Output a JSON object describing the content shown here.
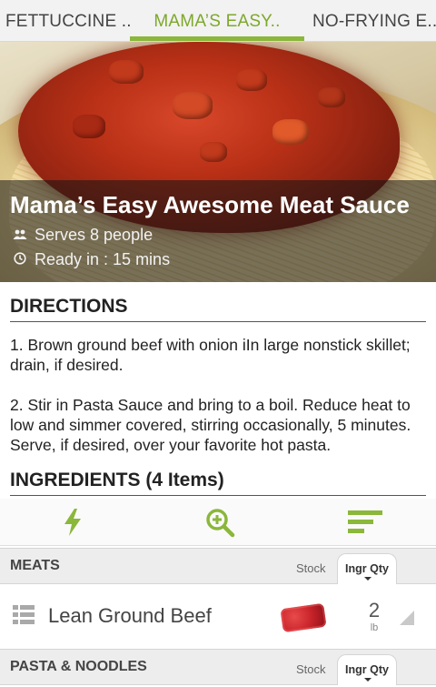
{
  "tabs": [
    {
      "label": "FETTUCCINE .."
    },
    {
      "label": "MAMA’S EASY.."
    },
    {
      "label": "NO-FRYING E.."
    }
  ],
  "active_tab_index": 1,
  "accent_color": "#8bb73a",
  "recipe": {
    "title": "Mama’s Easy Awesome Meat Sauce",
    "serves": "Serves 8 people",
    "ready": "Ready in :  15 mins",
    "serves_icon": "people-icon",
    "ready_icon": "clock-icon"
  },
  "directions": {
    "heading": "DIRECTIONS",
    "steps": [
      "1. Brown ground beef with onion iIn large nonstick skillet; drain, if desired.",
      "2. Stir in Pasta Sauce and bring to a boil. Reduce heat to low and simmer covered, stirring occasionally, 5 minutes. Serve, if desired, over your favorite hot pasta."
    ]
  },
  "ingredients": {
    "heading": "INGREDIENTS (4 Items)",
    "toolbar": [
      "lightning-icon",
      "zoom-in-icon",
      "sort-icon"
    ],
    "categories": [
      {
        "name": "MEATS",
        "stock_label": "Stock",
        "qty_label": "Ingr Qty",
        "items": [
          {
            "name": "Lean Ground Beef",
            "qty": "2",
            "unit": "lb"
          }
        ]
      },
      {
        "name": "PASTA & NOODLES",
        "stock_label": "Stock",
        "qty_label": "Ingr Qty",
        "items": []
      }
    ]
  }
}
